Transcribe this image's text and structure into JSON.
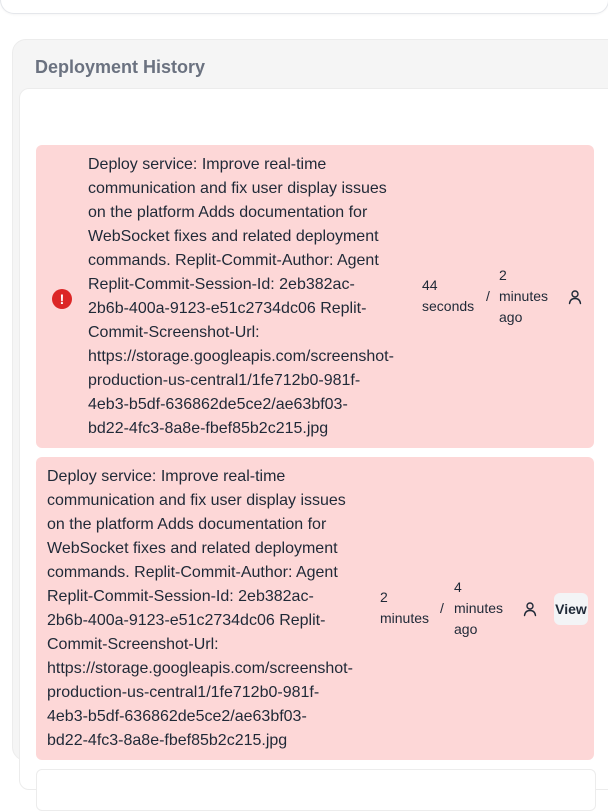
{
  "section": {
    "title": "Deployment History"
  },
  "deployments": [
    {
      "message_lines": [
        "Deploy service: Improve real-time",
        "communication and fix user display issues",
        "on the platform Adds documentation for",
        "WebSocket fixes and related deployment",
        "commands. Replit-Commit-Author: Agent",
        "Replit-Commit-Session-Id: 2eb382ac-",
        "2b6b-400a-9123-e51c2734dc06 Replit-",
        "Commit-Screenshot-Url:",
        "https://storage.googleapis.com/screenshot-",
        "production-us-central1/1fe712b0-981f-",
        "4eb3-b5df-636862de5ce2/ae63bf03-",
        "bd22-4fc3-8a8e-fbef85b2c215.jpg"
      ],
      "status": "failed",
      "status_icon": "exclamation-circle-icon",
      "duration_lines": [
        "44",
        "seconds"
      ],
      "separator": "/",
      "time_ago_lines": [
        "2",
        "minutes",
        "ago"
      ],
      "user_icon": "user-icon"
    },
    {
      "message_lines": [
        "Deploy service: Improve real-time",
        "communication and fix user display issues",
        "on the platform Adds documentation for",
        "WebSocket fixes and related deployment",
        "commands. Replit-Commit-Author: Agent",
        "Replit-Commit-Session-Id: 2eb382ac-",
        "2b6b-400a-9123-e51c2734dc06 Replit-",
        "Commit-Screenshot-Url:",
        "https://storage.googleapis.com/screenshot-",
        "production-us-central1/1fe712b0-981f-",
        "4eb3-b5df-636862de5ce2/ae63bf03-",
        "bd22-4fc3-8a8e-fbef85b2c215.jpg"
      ],
      "duration_lines": [
        "2",
        "minutes"
      ],
      "separator": "/",
      "time_ago_lines": [
        "4",
        "minutes",
        "ago"
      ],
      "user_icon": "user-icon",
      "view_label": "View"
    }
  ],
  "colors": {
    "row_error_bg": "#fdd7d7",
    "error_icon": "#dc2626",
    "title": "#6b7280"
  }
}
